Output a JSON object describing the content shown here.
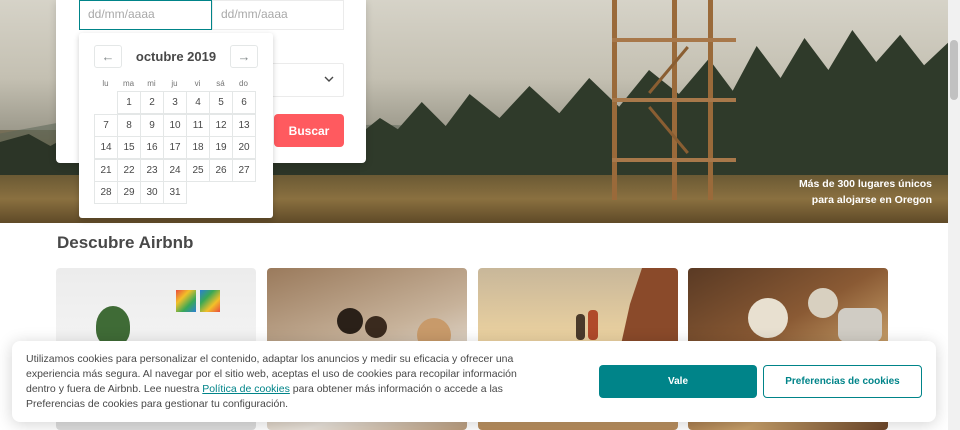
{
  "search": {
    "checkin_placeholder": "dd/mm/aaaa",
    "checkout_placeholder": "dd/mm/aaaa",
    "search_button": "Buscar"
  },
  "calendar": {
    "month_title": "octubre 2019",
    "prev_icon": "←",
    "next_icon": "→",
    "weekdays": [
      "lu",
      "ma",
      "mi",
      "ju",
      "vi",
      "sá",
      "do"
    ],
    "days": [
      "1",
      "2",
      "3",
      "4",
      "5",
      "6",
      "7",
      "8",
      "9",
      "10",
      "11",
      "12",
      "13",
      "14",
      "15",
      "16",
      "17",
      "18",
      "19",
      "20",
      "21",
      "22",
      "23",
      "24",
      "25",
      "26",
      "27",
      "28",
      "29",
      "30",
      "31"
    ]
  },
  "hero": {
    "caption_line1": "Más de 300 lugares únicos",
    "caption_line2": "para alojarse en Oregon"
  },
  "discover": {
    "title": "Descubre Airbnb"
  },
  "cookie_banner": {
    "text_before_link": "Utilizamos cookies para personalizar el contenido, adaptar los anuncios y medir su eficacia y ofrecer una experiencia más segura. Al navegar por el sitio web, aceptas el uso de cookies para recopilar información dentro y fuera de Airbnb. Lee nuestra ",
    "link_text": "Política de cookies",
    "text_after_link": " para obtener más información o accede a las Preferencias de cookies para gestionar tu configuración.",
    "accept_button": "Vale",
    "preferences_button": "Preferencias de cookies"
  },
  "colors": {
    "brand_red": "#ff5a5f",
    "teal": "#008489"
  }
}
